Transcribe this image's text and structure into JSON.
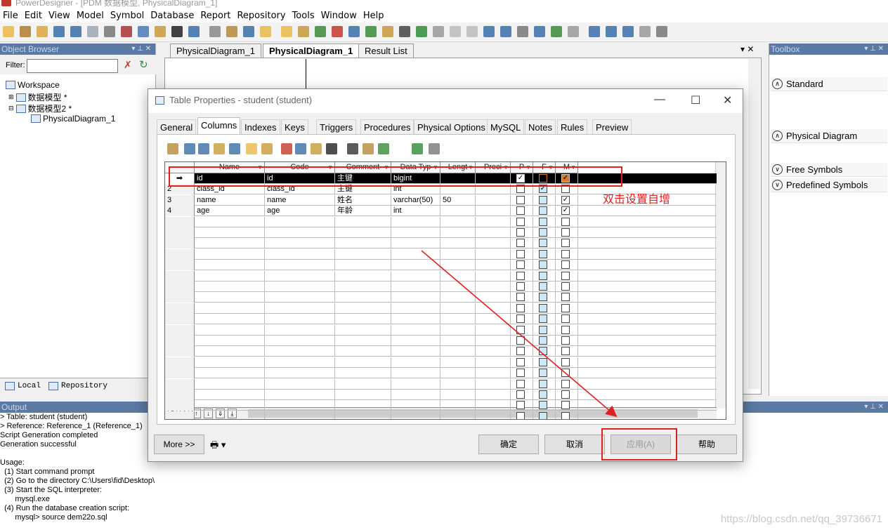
{
  "window": {
    "title": "PowerDesigner - [PDM 数据模型, PhysicalDiagram_1]"
  },
  "menubar": [
    "File",
    "Edit",
    "View",
    "Model",
    "Symbol",
    "Database",
    "Report",
    "Repository",
    "Tools",
    "Window",
    "Help"
  ],
  "object_browser": {
    "title": "Object Browser",
    "filter_label": "Filter:",
    "filter_value": "",
    "tree": [
      "Workspace",
      "数据模型 *",
      "数据模型2 *",
      "PhysicalDiagram_1"
    ],
    "tabs": [
      "Local",
      "Repository"
    ]
  },
  "document_tabs": [
    "PhysicalDiagram_1",
    "PhysicalDiagram_1",
    "Result List"
  ],
  "toolbox": {
    "title": "Toolbox",
    "sections": [
      "Standard",
      "Physical Diagram",
      "Free Symbols",
      "Predefined Symbols"
    ]
  },
  "output": {
    "title": "Output",
    "lines": [
      "> Table: student (student)",
      "> Reference: Reference_1 (Reference_1)",
      "Script Generation completed",
      "Generation successful",
      "",
      "Usage:",
      "  (1) Start command prompt",
      "  (2) Go to the directory C:\\Users\\fid\\Desktop\\",
      "  (3) Start the SQL interpreter:",
      "       mysql.exe",
      "  (4) Run the database creation script:",
      "       mysql> source dem22o.sql"
    ]
  },
  "watermark": "https://blog.csdn.net/qq_39736671",
  "dialog": {
    "title": "Table Properties - student (student)",
    "tabs": [
      "General",
      "Columns",
      "Indexes",
      "Keys",
      "Triggers",
      "Procedures",
      "Physical Options",
      "MySQL",
      "Notes",
      "Rules",
      "Preview"
    ],
    "active_tab": "Columns",
    "grid": {
      "headers": [
        "Name",
        "Code",
        "Comment",
        "Data Typ",
        "Lengt",
        "Preci",
        "P",
        "F",
        "M"
      ],
      "rows": [
        {
          "num": "",
          "name": "id",
          "code": "id",
          "comment": "主键",
          "type": "bigint",
          "length": "",
          "p": true,
          "f": false,
          "m": true
        },
        {
          "num": "2",
          "name": "class_id",
          "code": "class_id",
          "comment": "主键",
          "type": "int",
          "length": "",
          "p": false,
          "f": true,
          "m": false
        },
        {
          "num": "3",
          "name": "name",
          "code": "name",
          "comment": "姓名",
          "type": "varchar(50)",
          "length": "50",
          "p": false,
          "f": false,
          "m": true
        },
        {
          "num": "4",
          "name": "age",
          "code": "age",
          "comment": "年龄",
          "type": "int",
          "length": "",
          "p": false,
          "f": false,
          "m": true
        }
      ],
      "empty_rows": 21
    },
    "buttons": {
      "more": "More >>",
      "ok": "确定",
      "cancel": "取消",
      "apply": "应用(A)",
      "help": "帮助"
    }
  },
  "annotation": "双击设置自增"
}
